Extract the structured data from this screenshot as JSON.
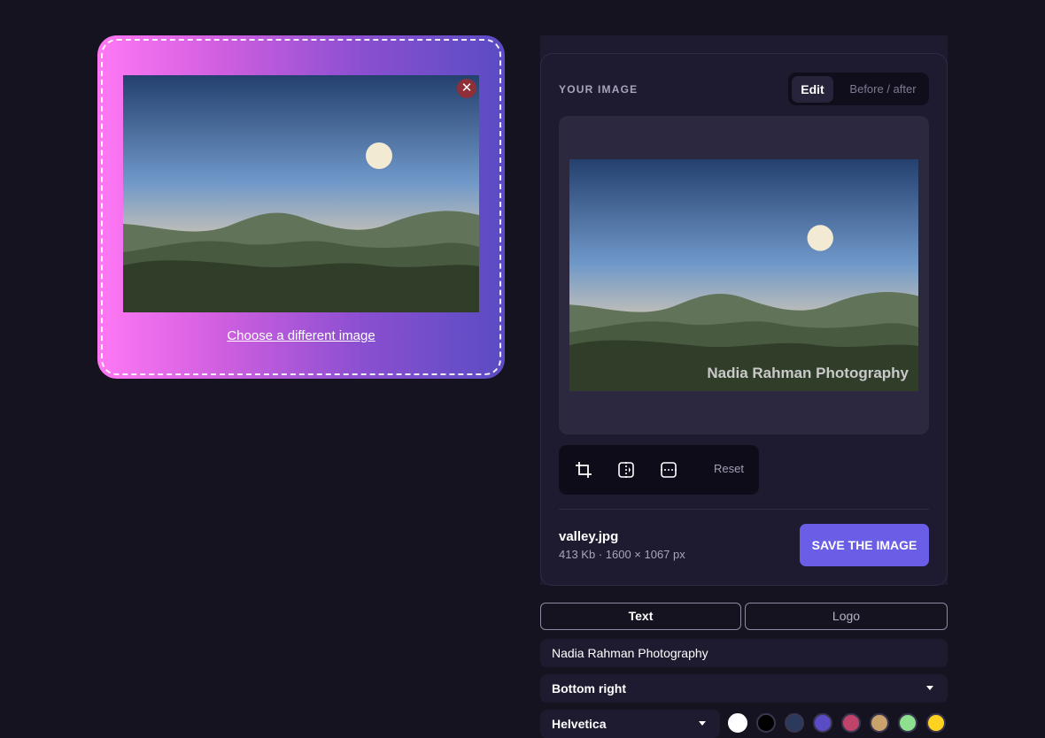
{
  "uploader": {
    "change_link": "Choose a different image",
    "remove_icon": "close-icon",
    "image_name": "valley.jpg"
  },
  "panel": {
    "title": "YOUR IMAGE",
    "mode_tabs": {
      "edit": "Edit",
      "before_after": "Before / after",
      "active": "Edit"
    },
    "watermark_text": "Nadia Rahman Photography",
    "tools": {
      "crop_icon": "crop-icon",
      "flip_horizontal_icon": "flip-horizontal-icon",
      "flip_vertical_icon": "flip-vertical-icon",
      "reset_label": "Reset"
    },
    "file": {
      "name": "valley.jpg",
      "meta": "413 Kb · 1600 × 1067 px"
    },
    "save_label": "SAVE THE IMAGE"
  },
  "watermark_tabs": {
    "text": "Text",
    "logo": "Logo",
    "active": "Text"
  },
  "watermark_text_value": "Nadia Rahman Photography",
  "position": {
    "selected": "Bottom right"
  },
  "font": {
    "selected": "Helvetica"
  },
  "colors": {
    "selected": "#ffffff",
    "swatches": [
      "#ffffff",
      "#000000",
      "#2b3a5c",
      "#5a4cc4",
      "#c0446a",
      "#c9a36b",
      "#8ee08e",
      "#ffd21f"
    ]
  },
  "accent": "#6b5ee6"
}
